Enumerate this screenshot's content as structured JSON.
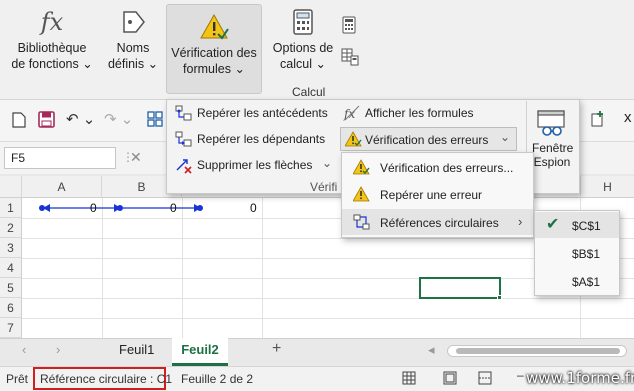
{
  "ribbon": {
    "fx_glyph": "fx",
    "lib_line1": "Bibliothèque",
    "lib_line2": "de fonctions",
    "names_line1": "Noms",
    "names_line2": "définis",
    "verif_line1": "Vérification des",
    "verif_line2": "formules",
    "calc_line1": "Options de",
    "calc_line2": "calcul",
    "group_label": "Calcul"
  },
  "formulas_menu": {
    "trace_precedents": "Repérer les antécédents",
    "trace_dependents": "Repérer les dépendants",
    "remove_arrows": "Supprimer les flèches",
    "show_formulas": "Afficher les formules",
    "error_checking": "Vérification des erreurs",
    "truncated_group": "Vérifi",
    "watch_line1": "Fenêtre",
    "watch_line2": "Espion"
  },
  "error_menu": {
    "item1": "Vérification des erreurs...",
    "item2": "Repérer une erreur",
    "item3": "Références circulaires"
  },
  "circular_menu": {
    "items": [
      "$C$1",
      "$B$1",
      "$A$1"
    ],
    "checked_index": 0
  },
  "formula_bar": {
    "namebox": "F5"
  },
  "grid": {
    "columns": [
      "A",
      "B",
      "H"
    ],
    "rows": [
      "1",
      "2",
      "3",
      "4",
      "5",
      "6",
      "7"
    ],
    "values": {
      "a1": "0",
      "b1": "0",
      "c1": "0"
    }
  },
  "qat": {
    "right_label": "x"
  },
  "tabs": {
    "sheet1": "Feuil1",
    "sheet2": "Feuil2",
    "add": "+"
  },
  "status": {
    "ready": "Prêt",
    "circular": "Référence circulaire : C1",
    "sheet_info": "Feuille 2 de 2",
    "watermark": "www.1forme.fr"
  },
  "colors": {
    "accent": "#1e7145",
    "highlight": "#d01f1f",
    "arrow": "#1a33d6"
  }
}
